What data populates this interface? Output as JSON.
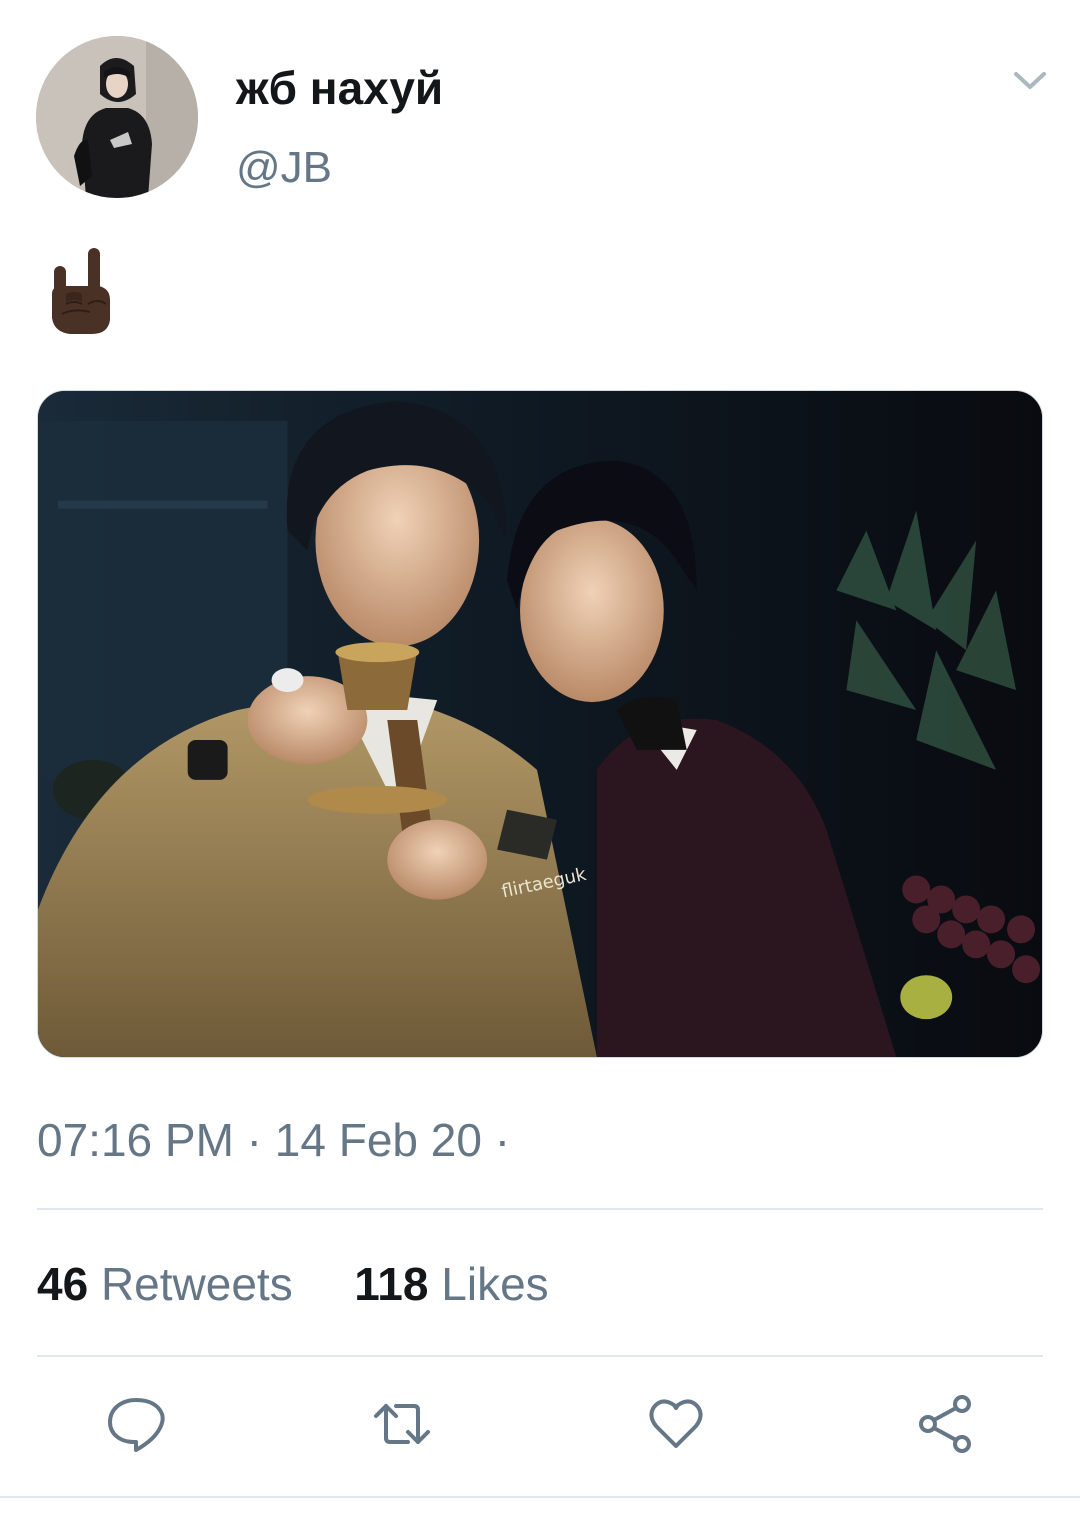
{
  "author": {
    "display_name": "жб нахуй",
    "handle": "@JB",
    "avatar_icon": "profile-photo"
  },
  "tweet": {
    "text_emoji": "sign-of-the-horns-emoji",
    "media_watermark": "flirtaeguk",
    "timestamp": "07:16 PM · 14 Feb 20 ·"
  },
  "stats": {
    "retweets_count": "46",
    "retweets_label": "Retweets",
    "likes_count": "118",
    "likes_label": "Likes"
  },
  "actions": [
    {
      "icon": "reply-icon"
    },
    {
      "icon": "retweet-icon"
    },
    {
      "icon": "like-icon"
    },
    {
      "icon": "share-icon"
    }
  ],
  "colors": {
    "primary_text": "#14171a",
    "secondary_text": "#657786",
    "divider": "#e1e8ed",
    "icon": "#657786"
  }
}
